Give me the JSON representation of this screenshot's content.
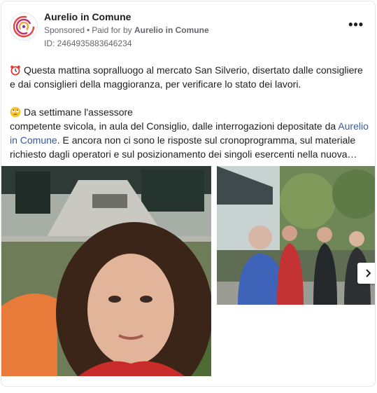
{
  "post": {
    "page_name": "Aurelio in Comune",
    "sponsored_label": "Sponsored",
    "paid_prefix": "Paid for by",
    "paid_by": "Aurelio in Comune",
    "ad_id": "ID: 2464935883646234",
    "more_label": "•••",
    "paragraph1": "Questa mattina sopralluogo al mercato San Silverio, disertato dalle consigliere e dai consiglieri della maggioranza, per verificare lo stato dei lavori.",
    "paragraph2_line1": "Da settimane l'assessore",
    "paragraph2_before_link": "competente svicola, in aula del Consiglio, dalle interrogazioni depositate da ",
    "paragraph2_link": "Aurelio in Comune",
    "paragraph2_after_link": ". E ancora non ci sono le risposte sul cronoprogramma, sul materiale richiesto dagli operatori e sul posizionamento dei singoli esercenti nella nuova…"
  },
  "icons": {
    "avatar": "spiral-logo-icon",
    "alarm": "alarm-clock-icon",
    "eye_roll": "eye-roll-emoji-icon",
    "next": "chevron-right-icon",
    "more": "more-options-icon"
  },
  "colors": {
    "link": "#385898",
    "secondary_text": "#65676b",
    "logo_red": "#e8433f",
    "logo_orange": "#f4a23a"
  }
}
